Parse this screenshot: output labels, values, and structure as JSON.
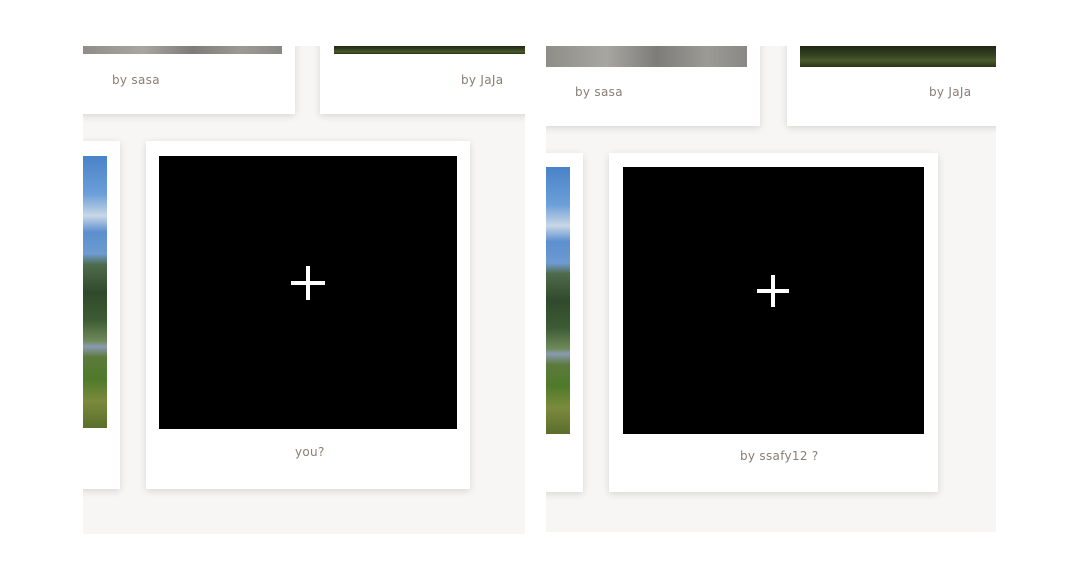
{
  "left_panel": {
    "top_cards": [
      {
        "caption": "by sasa"
      },
      {
        "caption": "by JaJa"
      }
    ],
    "add_card": {
      "caption": "you?",
      "add_icon": "plus-icon"
    }
  },
  "right_panel": {
    "top_cards": [
      {
        "caption": "by sasa"
      },
      {
        "caption": "by JaJa"
      }
    ],
    "add_card": {
      "caption": "by ssafy12 ?",
      "add_icon": "plus-icon"
    }
  },
  "colors": {
    "page_background": "#ffffff",
    "panel_background": "#f7f6f4",
    "card_background": "#ffffff",
    "caption_text": "#8a7d74",
    "add_tile": "#000000",
    "add_icon": "#ffffff"
  }
}
